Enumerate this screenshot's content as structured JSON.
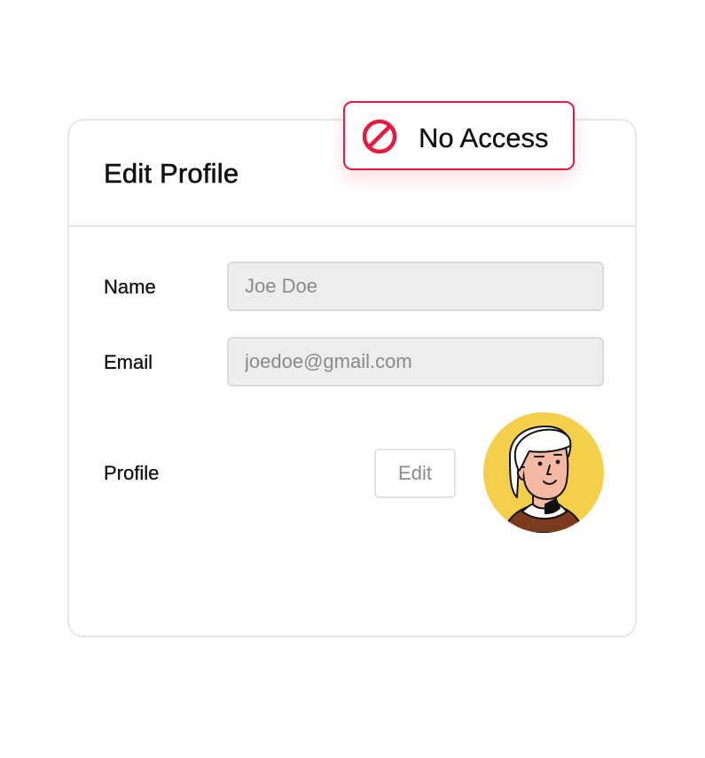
{
  "form": {
    "title": "Edit Profile",
    "name_label": "Name",
    "name_placeholder": "Joe Doe",
    "email_label": "Email",
    "email_placeholder": "joedoe@gmail.com",
    "profile_label": "Profile",
    "edit_label": "Edit"
  },
  "badge": {
    "text": "No Access",
    "icon": "no-access-icon",
    "color": "#e8193f"
  },
  "avatar": {
    "icon": "user-avatar",
    "background": "#f4d04a"
  }
}
